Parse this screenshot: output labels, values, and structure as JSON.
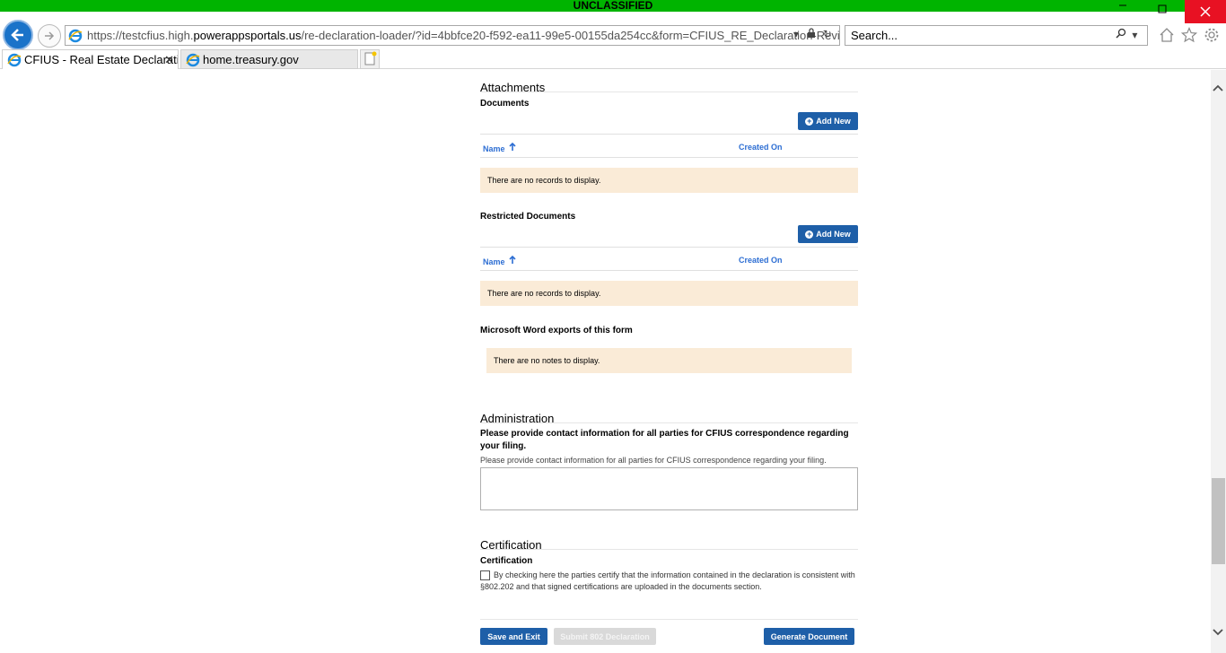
{
  "banner": {
    "text": "UNCLASSIFIED",
    "color": "#00b400"
  },
  "browser": {
    "url_prefix": "https://testcfius.high.",
    "url_host": "powerappsportals.us",
    "url_path": "/re-declaration-loader/?id=4bbfce20-f592-ea11-99e5-00155da254cc&form=CFIUS_RE_Declaration-Review",
    "search_placeholder": "Search...",
    "tabs": [
      {
        "label": "CFIUS - Real Estate Declarati...",
        "active": true
      },
      {
        "label": "home.treasury.gov",
        "active": false
      }
    ],
    "icons": [
      "back-icon",
      "forward-icon",
      "home-icon",
      "favorites-star-icon",
      "settings-gear-icon"
    ]
  },
  "attachments": {
    "title": "Attachments",
    "documents": {
      "label": "Documents",
      "add_label": "Add New",
      "columns": [
        "Name",
        "Created On"
      ],
      "empty_text": "There are no records to display."
    },
    "restricted": {
      "label": "Restricted Documents",
      "add_label": "Add New",
      "columns": [
        "Name",
        "Created On"
      ],
      "empty_text": "There are no records to display."
    },
    "exports": {
      "label": "Microsoft Word exports of this form",
      "empty_text": "There are no notes to display."
    }
  },
  "administration": {
    "title": "Administration",
    "question": "Please provide contact information for all parties for CFIUS correspondence regarding your filing.",
    "helper": "Please provide contact information for all parties for CFIUS correspondence regarding your filing.",
    "value": ""
  },
  "certification": {
    "title": "Certification",
    "label": "Certification",
    "text": "By checking here the parties certify that the information contained in the declaration is consistent with §802.202 and that signed certifications are uploaded in the documents section.",
    "checked": false
  },
  "actions": {
    "save_exit": "Save and Exit",
    "submit": "Submit 802 Declaration",
    "generate": "Generate Document"
  },
  "colors": {
    "primary_button": "#1e5fa8",
    "link": "#2d6ed3",
    "empty_bg": "#faebd7",
    "close_red": "#e81123"
  }
}
